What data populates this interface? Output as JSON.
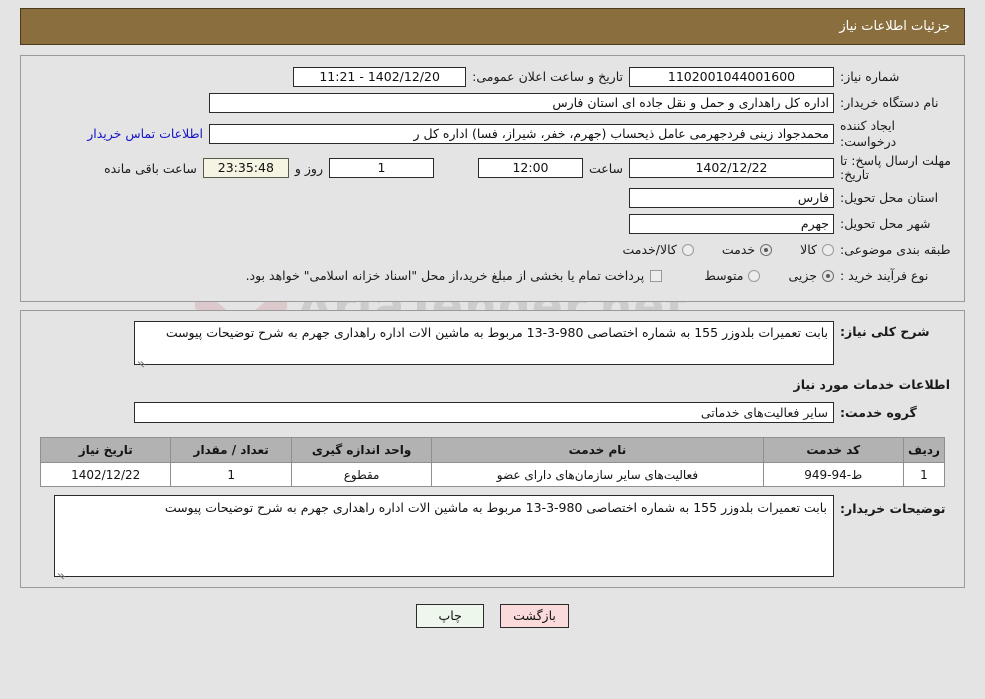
{
  "header": {
    "title": "جزئیات اطلاعات نیاز"
  },
  "info": {
    "need_number_label": "شماره نیاز:",
    "need_number_value": "1102001044001600",
    "announce_label": "تاریخ و ساعت اعلان عمومی:",
    "announce_value": "1402/12/20 - 11:21",
    "buyer_org_label": "نام دستگاه خریدار:",
    "buyer_org_value": "اداره کل راهداری و حمل و نقل جاده ای استان فارس",
    "requester_label": "ایجاد کننده درخواست:",
    "requester_value": "محمدجواد زینی فردجهرمی عامل ذیحساب (جهرم، خفر، شیراز، فسا) اداره کل ر",
    "contact_link": "اطلاعات تماس خریدار",
    "deadline_label": "مهلت ارسال پاسخ: تا تاریخ:",
    "deadline_date": "1402/12/22",
    "time_label": "ساعت",
    "deadline_time": "12:00",
    "days_value": "1",
    "days_label": "روز و",
    "countdown_value": "23:35:48",
    "countdown_label": "ساعت باقی مانده",
    "province_label": "استان محل تحویل:",
    "province_value": "فارس",
    "city_label": "شهر محل تحویل:",
    "city_value": "جهرم",
    "category_label": "طبقه بندی موضوعی:",
    "category_options": [
      {
        "label": "کالا",
        "checked": false
      },
      {
        "label": "خدمت",
        "checked": true
      },
      {
        "label": "کالا/خدمت",
        "checked": false
      }
    ],
    "process_label": "نوع فرآیند خرید :",
    "process_options": [
      {
        "label": "جزیی",
        "checked": true
      },
      {
        "label": "متوسط",
        "checked": false
      }
    ],
    "treasury_note": "پرداخت تمام یا بخشی از مبلغ خرید،از محل \"اسناد خزانه اسلامی\" خواهد بود.",
    "treasury_checked": false
  },
  "details": {
    "summary_label": "شرح کلی نیاز:",
    "summary_value": "بابت تعمیرات بلدوزر 155 به شماره اختصاصی 980-3-13 مربوط به ماشین الات اداره راهداری جهرم به شرح توضیحات پیوست",
    "services_heading": "اطلاعات خدمات مورد نیاز",
    "service_group_label": "گروه خدمت:",
    "service_group_value": "سایر فعالیت‌های خدماتی"
  },
  "table": {
    "headers": [
      "ردیف",
      "کد خدمت",
      "نام خدمت",
      "واحد اندازه گیری",
      "تعداد / مقدار",
      "تاریخ نیاز"
    ],
    "rows": [
      {
        "radif": "1",
        "code": "ط-94-949",
        "name": "فعالیت‌های سایر سازمان‌های دارای عضو",
        "unit": "مقطوع",
        "qty": "1",
        "date": "1402/12/22"
      }
    ]
  },
  "buyer_notes": {
    "label": "توضیحات خریدار:",
    "value": "بابت تعمیرات بلدوزر 155 به شماره اختصاصی 980-3-13 مربوط به ماشین الات اداره راهداری جهرم به شرح توضیحات پیوست"
  },
  "footer": {
    "print_label": "چاپ",
    "back_label": "بازگشت"
  },
  "watermark": {
    "text": "AriaTender.net"
  }
}
